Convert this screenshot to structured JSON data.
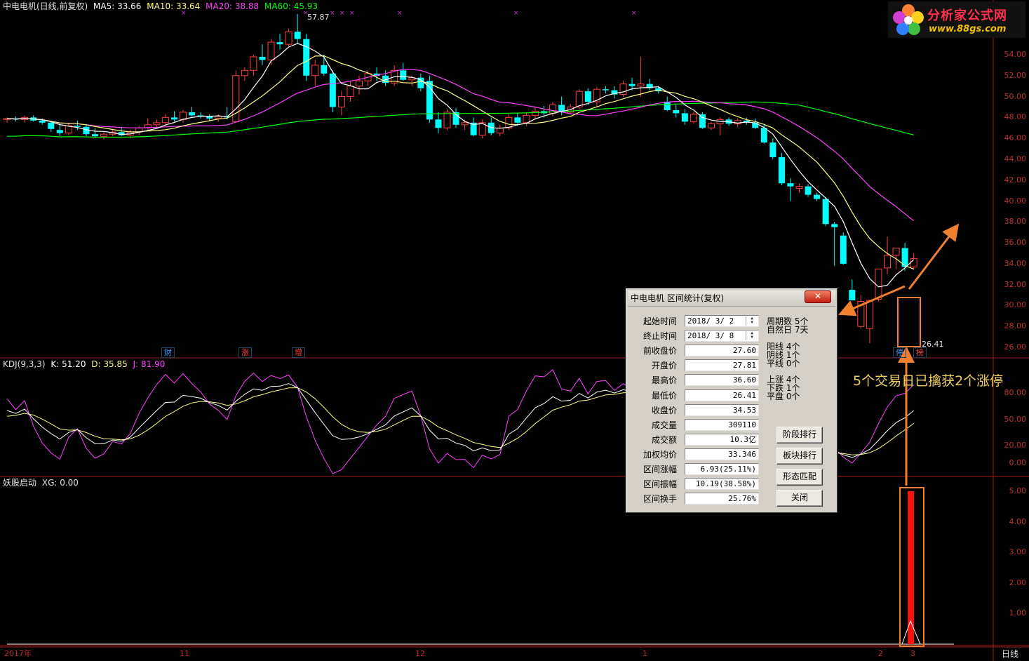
{
  "main_header": {
    "stock": "中电电机(日线,前复权)",
    "ma5": "MA5: 33.66",
    "ma10": "MA10: 33.64",
    "ma20": "MA20: 38.88",
    "ma60": "MA60: 45.93"
  },
  "peak_label": "57.87",
  "low_label": "26.41",
  "price_axis": [
    "54.00",
    "52.00",
    "50.00",
    "48.00",
    "46.00",
    "44.00",
    "42.00",
    "40.00",
    "38.00",
    "36.00",
    "34.00",
    "32.00",
    "30.00",
    "28.00",
    "26.00"
  ],
  "kdj_header": {
    "name": "KDJ(9,3,3)",
    "k": "K: 51.20",
    "d": "D: 35.85",
    "j": "J: 81.90"
  },
  "kdj_axis": [
    "80.00",
    "50.00",
    "20.00",
    "0.00"
  ],
  "ind_header": {
    "name": "妖股启动",
    "xg": "XG: 0.00"
  },
  "ind_axis": [
    "5.00",
    "4.00",
    "3.00",
    "2.00",
    "1.00"
  ],
  "time_axis": [
    "2017年",
    "11",
    "12",
    "1",
    "2",
    "3"
  ],
  "period_label": "日线",
  "events": [
    {
      "label": "财",
      "color": "#40a0ff"
    },
    {
      "label": "涨",
      "color": "#ff4040"
    },
    {
      "label": "增",
      "color": "#ff4040"
    },
    {
      "label": "停",
      "color": "#40a0ff"
    },
    {
      "label": "榜",
      "color": "#ff4040"
    }
  ],
  "colors": {
    "up": "#ff4040",
    "down": "#00ffff",
    "ma5": "#ffffff",
    "ma10": "#ffff80",
    "ma20": "#ff40ff",
    "ma60": "#00ff00",
    "accent": "#f08030"
  },
  "chart_data": {
    "type": "candlestick",
    "ylim": [
      25,
      55
    ],
    "candles": [
      [
        47.8,
        48.0,
        47.5,
        47.9
      ],
      [
        47.9,
        48.1,
        47.6,
        47.8
      ],
      [
        47.8,
        48.2,
        47.5,
        48.0
      ],
      [
        48.0,
        48.2,
        47.6,
        47.7
      ],
      [
        47.7,
        47.9,
        47.3,
        47.5
      ],
      [
        47.5,
        47.6,
        46.6,
        46.9
      ],
      [
        46.8,
        47.3,
        46.2,
        46.5
      ],
      [
        46.5,
        47.4,
        46.3,
        47.2
      ],
      [
        47.2,
        47.7,
        46.8,
        47.1
      ],
      [
        47.1,
        47.3,
        46.2,
        46.4
      ],
      [
        46.4,
        47.0,
        46.0,
        46.2
      ],
      [
        46.2,
        46.6,
        45.9,
        46.4
      ],
      [
        46.4,
        46.9,
        46.2,
        46.6
      ],
      [
        46.6,
        47.1,
        46.2,
        46.3
      ],
      [
        46.3,
        46.8,
        46.0,
        46.6
      ],
      [
        46.6,
        47.2,
        46.3,
        47.0
      ],
      [
        47.0,
        47.9,
        46.8,
        47.3
      ],
      [
        47.3,
        47.8,
        47.0,
        47.5
      ],
      [
        47.5,
        48.3,
        47.2,
        48.0
      ],
      [
        48.0,
        48.6,
        47.6,
        47.8
      ],
      [
        47.8,
        48.7,
        47.5,
        48.5
      ],
      [
        48.5,
        49.0,
        48.1,
        48.2
      ],
      [
        48.2,
        48.5,
        47.9,
        48.1
      ],
      [
        48.1,
        48.3,
        47.7,
        47.9
      ],
      [
        47.9,
        48.3,
        47.6,
        48.1
      ],
      [
        48.1,
        49.0,
        47.8,
        48.0
      ],
      [
        47.6,
        52.5,
        47.5,
        52.0
      ],
      [
        52.0,
        52.8,
        51.5,
        52.5
      ],
      [
        52.5,
        54.0,
        52.0,
        53.8
      ],
      [
        53.8,
        55.0,
        53.0,
        53.5
      ],
      [
        53.5,
        55.5,
        53.0,
        55.2
      ],
      [
        55.2,
        56.0,
        54.5,
        55.0
      ],
      [
        55.0,
        56.5,
        54.8,
        56.2
      ],
      [
        56.2,
        57.9,
        55.0,
        55.5
      ],
      [
        55.5,
        56.0,
        51.5,
        52.0
      ],
      [
        52.0,
        53.5,
        51.0,
        53.0
      ],
      [
        53.0,
        54.0,
        52.0,
        52.2
      ],
      [
        52.2,
        52.5,
        48.5,
        49.0
      ],
      [
        49.0,
        50.5,
        48.2,
        50.0
      ],
      [
        50.0,
        51.5,
        49.5,
        51.0
      ],
      [
        51.0,
        52.0,
        50.2,
        51.5
      ],
      [
        51.5,
        52.5,
        51.0,
        52.2
      ],
      [
        52.2,
        52.8,
        51.5,
        52.0
      ],
      [
        52.0,
        52.5,
        51.0,
        51.3
      ],
      [
        51.3,
        53.0,
        51.0,
        52.5
      ],
      [
        52.5,
        53.2,
        51.5,
        51.6
      ],
      [
        51.6,
        52.0,
        51.0,
        51.8
      ],
      [
        51.8,
        52.2,
        50.5,
        50.8
      ],
      [
        51.5,
        52.0,
        47.5,
        47.8
      ],
      [
        47.8,
        48.5,
        46.5,
        47.0
      ],
      [
        47.0,
        48.8,
        46.8,
        48.5
      ],
      [
        48.5,
        48.9,
        47.0,
        47.3
      ],
      [
        47.3,
        47.8,
        46.8,
        47.5
      ],
      [
        47.5,
        48.0,
        46.2,
        46.3
      ],
      [
        46.3,
        47.8,
        46.0,
        47.5
      ],
      [
        47.5,
        48.0,
        46.3,
        46.5
      ],
      [
        46.5,
        47.3,
        46.2,
        47.0
      ],
      [
        47.0,
        48.3,
        46.8,
        48.0
      ],
      [
        48.0,
        48.4,
        47.2,
        47.5
      ],
      [
        47.5,
        48.5,
        47.2,
        48.2
      ],
      [
        48.2,
        49.0,
        47.8,
        48.6
      ],
      [
        48.6,
        49.1,
        48.0,
        48.4
      ],
      [
        48.4,
        49.5,
        48.1,
        49.2
      ],
      [
        49.2,
        50.0,
        48.2,
        48.5
      ],
      [
        48.5,
        49.3,
        48.3,
        49.0
      ],
      [
        49.0,
        50.7,
        48.8,
        50.5
      ],
      [
        50.5,
        50.8,
        49.2,
        49.5
      ],
      [
        49.5,
        50.9,
        49.0,
        50.7
      ],
      [
        50.7,
        51.0,
        50.3,
        50.6
      ],
      [
        50.6,
        51.0,
        49.8,
        50.2
      ],
      [
        50.2,
        51.5,
        50.0,
        51.2
      ],
      [
        51.2,
        51.8,
        50.6,
        51.0
      ],
      [
        51.0,
        53.8,
        50.0,
        51.2
      ],
      [
        51.2,
        51.7,
        50.6,
        50.8
      ],
      [
        50.8,
        51.0,
        50.3,
        50.5
      ],
      [
        49.5,
        50.0,
        48.6,
        48.7
      ],
      [
        48.7,
        49.2,
        48.0,
        48.4
      ],
      [
        48.4,
        48.8,
        47.3,
        47.6
      ],
      [
        47.6,
        48.5,
        47.4,
        48.3
      ],
      [
        48.3,
        48.5,
        46.9,
        47.0
      ],
      [
        47.0,
        47.6,
        46.8,
        47.4
      ],
      [
        47.4,
        48.0,
        46.3,
        47.8
      ],
      [
        47.8,
        48.0,
        47.2,
        47.4
      ],
      [
        47.4,
        47.9,
        47.1,
        47.7
      ],
      [
        47.7,
        48.0,
        47.3,
        47.5
      ],
      [
        47.5,
        47.9,
        46.9,
        47.0
      ],
      [
        47.0,
        47.3,
        45.5,
        45.6
      ],
      [
        45.6,
        46.0,
        44.0,
        44.2
      ],
      [
        44.2,
        44.6,
        41.5,
        41.7
      ],
      [
        41.7,
        42.2,
        40.0,
        41.4
      ],
      [
        41.2,
        41.7,
        40.8,
        41.4
      ],
      [
        41.4,
        41.6,
        40.4,
        40.6
      ],
      [
        40.6,
        40.8,
        40.0,
        40.2
      ],
      [
        40.2,
        40.4,
        37.6,
        37.8
      ],
      [
        37.8,
        38.0,
        33.8,
        37.5
      ],
      [
        36.7,
        37.0,
        33.9,
        34.0
      ],
      [
        31.5,
        32.5,
        30.5,
        30.5
      ],
      [
        28.0,
        31.0,
        27.8,
        30.4
      ],
      [
        27.8,
        30.5,
        26.4,
        30.5
      ],
      [
        30.6,
        33.5,
        30.4,
        33.5
      ],
      [
        33.6,
        36.6,
        33.0,
        34.8
      ],
      [
        34.8,
        35.5,
        33.5,
        35.5
      ],
      [
        35.5,
        36.0,
        33.3,
        33.7
      ],
      [
        33.7,
        35.0,
        33.4,
        34.5
      ]
    ]
  },
  "dialog": {
    "title": "中电电机 区间统计(复权)",
    "close": "✕",
    "rows": [
      {
        "label": "起始时间",
        "value": "2018/ 3/ 2"
      },
      {
        "label": "终止时间",
        "value": "2018/ 3/ 8"
      },
      {
        "label": "前收盘价",
        "value": "27.60"
      },
      {
        "label": "开盘价",
        "value": "27.81"
      },
      {
        "label": "最高价",
        "value": "36.60"
      },
      {
        "label": "最低价",
        "value": "26.41"
      },
      {
        "label": "收盘价",
        "value": "34.53"
      },
      {
        "label": "成交量",
        "value": "309110"
      },
      {
        "label": "成交额",
        "value": "10.3亿"
      },
      {
        "label": "加权均价",
        "value": "33.346"
      },
      {
        "label": "区间涨幅",
        "value": "6.93(25.11%)"
      },
      {
        "label": "区间振幅",
        "value": "10.19(38.58%)"
      },
      {
        "label": "区间换手",
        "value": "25.76%"
      }
    ],
    "stats": [
      [
        "周期数 5个",
        "自然日 7天"
      ],
      [
        "阳线 4个",
        "阴线 1个",
        "平线 0个"
      ],
      [
        "上涨 4个",
        "下跌 1个",
        "平盘 0个"
      ]
    ],
    "buttons": [
      "阶段排行",
      "板块排行",
      "形态匹配",
      "关闭"
    ]
  },
  "annotation": "5个交易日已擒获2个涨停",
  "logo": {
    "name": "分析家公式网",
    "url": "www.88gs.com"
  }
}
